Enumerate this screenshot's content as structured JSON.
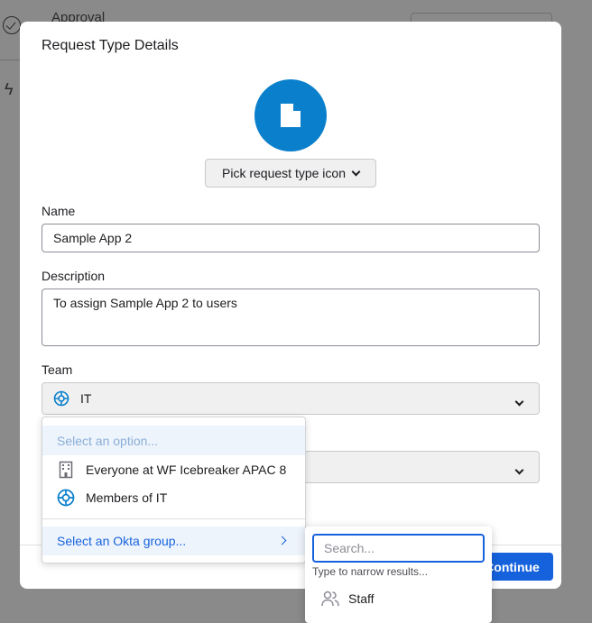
{
  "background": {
    "approval_label": "Approval"
  },
  "modal": {
    "title": "Request Type Details",
    "request_icon": "document-icon",
    "pick_icon_label": "Pick request type icon",
    "name_label": "Name",
    "name_value": "Sample App 2",
    "description_label": "Description",
    "description_value": "To assign Sample App 2 to users",
    "team_label": "Team",
    "team_value": "IT",
    "team_icon": "team-wheel-icon",
    "continue_label": "Continue",
    "accent_color": "#1662dd",
    "icon_color": "#0a80cc"
  },
  "team_menu": {
    "placeholder": "Select an option...",
    "items": [
      {
        "label": "Everyone at WF Icebreaker APAC 8",
        "icon": "building-icon"
      },
      {
        "label": "Members of IT",
        "icon": "team-wheel-icon"
      }
    ],
    "okta_group_label": "Select an Okta group..."
  },
  "okta_popover": {
    "search_placeholder": "Search...",
    "hint": "Type to narrow results...",
    "results": [
      {
        "label": "Staff",
        "icon": "people-icon"
      }
    ]
  }
}
